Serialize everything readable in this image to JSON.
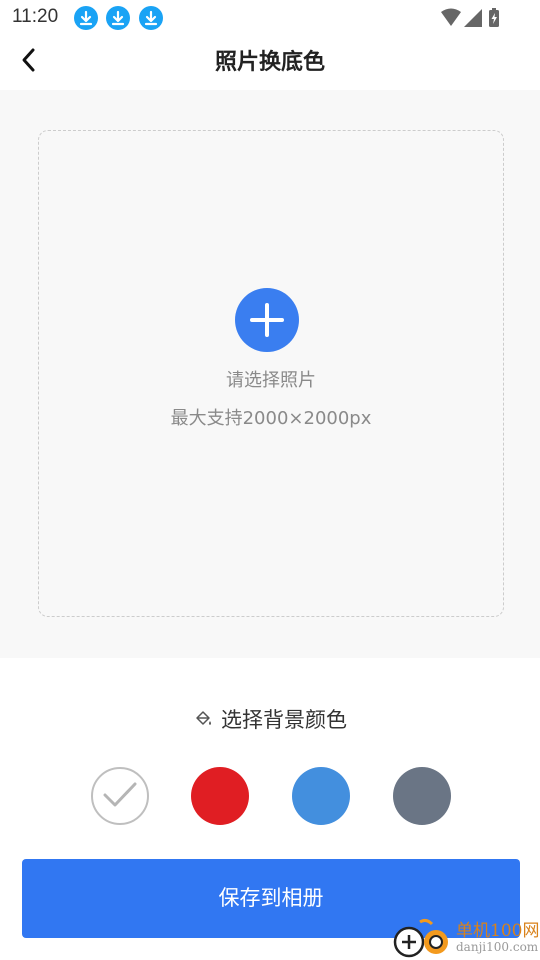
{
  "status_bar": {
    "time": "11:20",
    "notification_icons": [
      "download-icon",
      "download-icon",
      "download-icon"
    ],
    "system_icons": [
      "wifi-icon",
      "signal-icon",
      "battery-charging-icon"
    ]
  },
  "header": {
    "title": "照片换底色",
    "back_icon": "chevron-left-icon"
  },
  "upload": {
    "icon": "plus-icon",
    "label": "请选择照片",
    "hint": "最大支持2000×2000px"
  },
  "background_colors": {
    "title_icon": "paint-bucket-icon",
    "title": "选择背景颜色",
    "selected": "white",
    "swatches": [
      {
        "name": "white",
        "color": "#ffffff"
      },
      {
        "name": "red",
        "color": "#e01e23"
      },
      {
        "name": "blue",
        "color": "#438fde"
      },
      {
        "name": "gray",
        "color": "#6a7585"
      }
    ]
  },
  "actions": {
    "save_label": "保存到相册"
  },
  "watermark": {
    "brand": "单机100网",
    "url": "danji100.com"
  },
  "colors": {
    "accent": "#3177f2",
    "plus_button": "#3a7ef0",
    "notification_blue": "#1aa3f5"
  }
}
